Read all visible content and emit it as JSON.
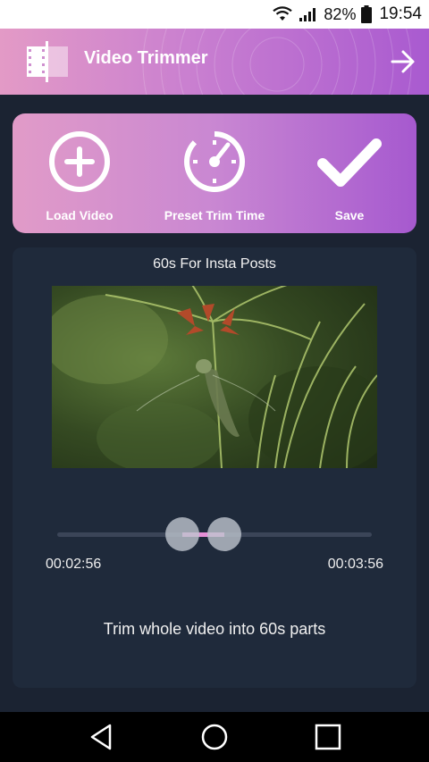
{
  "status_bar": {
    "battery_percent": "82%",
    "time": "19:54",
    "wifi_icon": "wifi-icon",
    "signal_icon": "signal-icon",
    "battery_icon": "battery-icon"
  },
  "app_bar": {
    "title": "Video Trimmer",
    "logo_icon": "film-strip-icon",
    "next_icon": "arrow-right-icon"
  },
  "actions": [
    {
      "label": "Load Video",
      "icon": "plus-circle-icon"
    },
    {
      "label": "Preset Trim Time",
      "icon": "gauge-timer-icon"
    },
    {
      "label": "Save",
      "icon": "checkmark-icon"
    }
  ],
  "panel": {
    "title": "60s For Insta Posts",
    "video_thumbnail": "dragonfly-on-plant",
    "trim": {
      "start_time": "00:02:56",
      "end_time": "00:03:56"
    },
    "info": "Trim whole video into 60s parts"
  },
  "nav_bar": {
    "back_icon": "back-triangle-icon",
    "home_icon": "home-circle-icon",
    "recent_icon": "recent-square-icon"
  },
  "colors": {
    "background": "#1b2332",
    "panel": "#1f2a3b",
    "accent_pink": "#e19bc8",
    "accent_purple": "#a659cf",
    "range": "#e58fd6"
  }
}
